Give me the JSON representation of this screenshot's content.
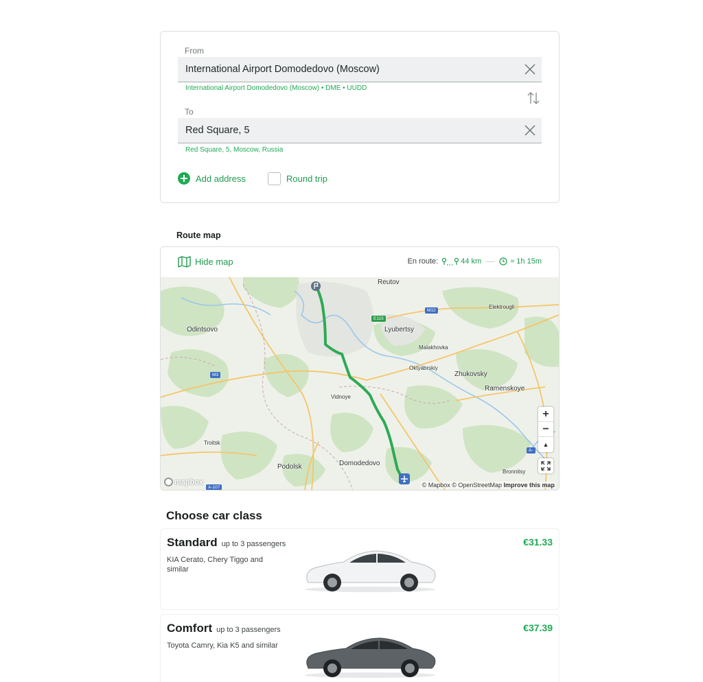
{
  "trip": {
    "from": {
      "label": "From",
      "value": "International Airport Domodedovo (Moscow)",
      "hint": "International Airport Domodedovo (Moscow) • DME • UUDD"
    },
    "to": {
      "label": "To",
      "value": "Red Square, 5",
      "hint": "Red Square, 5, Moscow, Russia"
    },
    "add_address_label": "Add address",
    "round_trip_label": "Round trip",
    "round_trip_checked": false
  },
  "route_map": {
    "section_title": "Route map",
    "hide_map_label": "Hide map",
    "en_route_label": "En route:",
    "distance": "44 km",
    "duration": "≈ 1h 15m",
    "cities": [
      "Reutov",
      "Elektrougli",
      "Odintsovo",
      "Lyubertsy",
      "Malakhovka",
      "Oktyabrskiy",
      "Zhukovsky",
      "Ramenskoye",
      "Vidnoye",
      "Troitsk",
      "Podolsk",
      "Domodedovo",
      "Bronnitsy"
    ],
    "road_shields": [
      "E115",
      "M12",
      "M3",
      "A-107",
      "A-"
    ],
    "zoom_in": "+",
    "zoom_out": "−",
    "compass": "▲",
    "attribution": {
      "mapbox": "© Mapbox",
      "osm": "© OpenStreetMap",
      "improve": "Improve this map"
    },
    "logo_text": "mapbox",
    "route_color": "#2eaa55",
    "marker_start_icon": "flag-icon",
    "marker_end_icon": "airplane-icon"
  },
  "car_classes": {
    "title": "Choose car class",
    "items": [
      {
        "name": "Standard",
        "passengers": "up to 3 passengers",
        "models": "KIA Cerato, Chery Tiggo and similar",
        "price": "€31.33",
        "car_color": "#f2f3f4"
      },
      {
        "name": "Comfort",
        "passengers": "up to 3 passengers",
        "models": "Toyota Camry, Kia K5 and similar",
        "price": "€37.39",
        "car_color": "#5d6266"
      }
    ]
  },
  "colors": {
    "accent": "#1faa55",
    "field_bg": "#eef0f1",
    "border": "#dcdfe0"
  }
}
